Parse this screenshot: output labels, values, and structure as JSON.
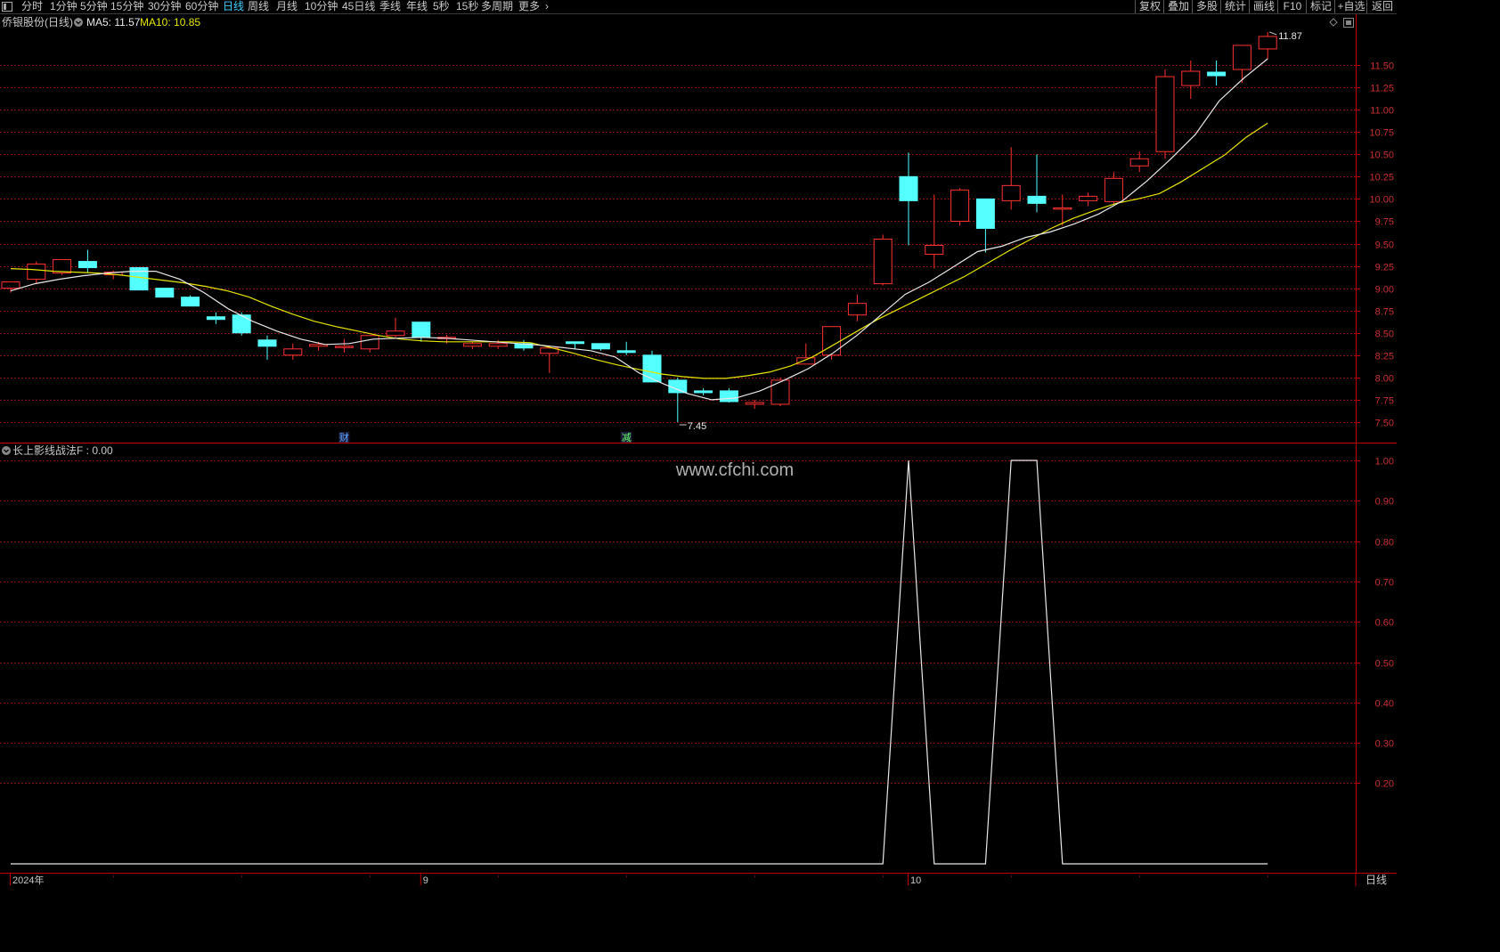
{
  "toolbar": {
    "left_icon": "panel-toggle-icon",
    "periods": [
      {
        "label": "分时",
        "active": false
      },
      {
        "label": "1分钟",
        "active": false
      },
      {
        "label": "5分钟",
        "active": false
      },
      {
        "label": "15分钟",
        "active": false
      },
      {
        "label": "30分钟",
        "active": false
      },
      {
        "label": "60分钟",
        "active": false
      },
      {
        "label": "日线",
        "active": true
      },
      {
        "label": "周线",
        "active": false
      },
      {
        "label": "月线",
        "active": false
      },
      {
        "label": "10分钟",
        "active": false
      },
      {
        "label": "45日线",
        "active": false
      },
      {
        "label": "季线",
        "active": false
      },
      {
        "label": "年线",
        "active": false
      },
      {
        "label": "5秒",
        "active": false
      },
      {
        "label": "15秒",
        "active": false
      },
      {
        "label": "多周期",
        "active": false
      },
      {
        "label": "更多",
        "active": false
      }
    ],
    "right_buttons": [
      "复权",
      "叠加",
      "多股",
      "统计",
      "画线",
      "F10",
      "标记",
      "+自选",
      "返回"
    ]
  },
  "main_chart": {
    "title": "侨银股份(日线)",
    "ma5_label": "MA5: 11.57",
    "ma10_label": "MA10: 10.85",
    "ma5_color": "#e8e8e8",
    "ma10_color": "#e5e500",
    "up_color": "#ff3232",
    "down_color": "#54ffff",
    "high_marker": "11.87",
    "low_marker": "7.45",
    "event_markers": [
      {
        "text": "财",
        "index": 13,
        "color": "#5fa8ff"
      },
      {
        "text": "减",
        "index": 24,
        "color": "#66ff66"
      }
    ],
    "icons": [
      "diamond-icon",
      "window-restore-icon"
    ]
  },
  "sub_chart": {
    "title": "长上影线战法F : 0.00",
    "watermark": "www.cfchi.com"
  },
  "x_axis": {
    "labels": [
      {
        "text": "2024年",
        "index": 0
      },
      {
        "text": "9",
        "index": 16
      },
      {
        "text": "10",
        "index": 35
      }
    ],
    "period_label": "日线"
  },
  "chart_data": [
    {
      "type": "candlestick",
      "title": "侨银股份(日线)",
      "y_ticks": [
        7.5,
        7.75,
        8.0,
        8.25,
        8.5,
        8.75,
        9.0,
        9.25,
        9.5,
        9.75,
        10.0,
        10.25,
        10.5,
        10.75,
        11.0,
        11.25,
        11.5
      ],
      "ylim": [
        7.25,
        11.95
      ],
      "series_legend": [
        {
          "name": "MA5",
          "value": 11.57
        },
        {
          "name": "MA10",
          "value": 10.85
        }
      ],
      "candles": [
        [
          9.0,
          9.07,
          8.95,
          9.0
        ],
        [
          9.1,
          9.27,
          9.05,
          9.3
        ],
        [
          9.17,
          9.32,
          9.15,
          9.32
        ],
        [
          9.3,
          9.23,
          9.17,
          9.43
        ],
        [
          9.15,
          9.18,
          9.1,
          9.2
        ],
        [
          9.23,
          8.98,
          8.98,
          9.23
        ],
        [
          9.0,
          8.9,
          8.9,
          9.0
        ],
        [
          8.9,
          8.8,
          8.8,
          8.92
        ],
        [
          8.68,
          8.65,
          8.6,
          8.73
        ],
        [
          8.7,
          8.5,
          8.47,
          8.73
        ],
        [
          8.42,
          8.35,
          8.2,
          8.47
        ],
        [
          8.25,
          8.32,
          8.2,
          8.38
        ],
        [
          8.35,
          8.37,
          8.3,
          8.4
        ],
        [
          8.35,
          8.35,
          8.28,
          8.43
        ],
        [
          8.32,
          8.47,
          8.28,
          8.47
        ],
        [
          8.47,
          8.52,
          8.45,
          8.67
        ],
        [
          8.62,
          8.45,
          8.4,
          8.62
        ],
        [
          8.45,
          8.45,
          8.38,
          8.48
        ],
        [
          8.35,
          8.38,
          8.32,
          8.4
        ],
        [
          8.35,
          8.38,
          8.32,
          8.42
        ],
        [
          8.38,
          8.33,
          8.3,
          8.42
        ],
        [
          8.27,
          8.33,
          8.05,
          8.33
        ],
        [
          8.4,
          8.38,
          8.32,
          8.4
        ],
        [
          8.38,
          8.32,
          8.3,
          8.38
        ],
        [
          8.3,
          8.28,
          8.25,
          8.4
        ],
        [
          8.25,
          7.95,
          7.95,
          8.3
        ],
        [
          7.97,
          7.83,
          7.5,
          8.0
        ],
        [
          7.85,
          7.83,
          7.8,
          7.88
        ],
        [
          7.85,
          7.73,
          7.72,
          7.88
        ],
        [
          7.7,
          7.72,
          7.65,
          7.75
        ],
        [
          7.7,
          7.97,
          7.68,
          8.0
        ],
        [
          8.15,
          8.22,
          8.15,
          8.38
        ],
        [
          8.25,
          8.57,
          8.2,
          8.57
        ],
        [
          8.7,
          8.83,
          8.63,
          8.93
        ],
        [
          9.05,
          9.55,
          9.03,
          9.6
        ],
        [
          10.25,
          9.98,
          9.48,
          10.52
        ],
        [
          9.38,
          9.48,
          9.22,
          10.05
        ],
        [
          9.75,
          10.1,
          9.7,
          10.12
        ],
        [
          10.0,
          9.67,
          9.4,
          10.0
        ],
        [
          9.98,
          10.15,
          9.88,
          10.58
        ],
        [
          10.03,
          9.95,
          9.85,
          10.5
        ],
        [
          9.9,
          9.9,
          9.7,
          10.05
        ],
        [
          9.98,
          10.03,
          9.92,
          10.07
        ],
        [
          9.97,
          10.23,
          9.93,
          10.3
        ],
        [
          10.37,
          10.45,
          10.3,
          10.53
        ],
        [
          10.53,
          11.37,
          10.45,
          11.45
        ],
        [
          11.27,
          11.43,
          11.12,
          11.55
        ],
        [
          11.42,
          11.38,
          11.27,
          11.55
        ],
        [
          11.45,
          11.72,
          11.3,
          11.72
        ],
        [
          11.68,
          11.82,
          11.57,
          11.87
        ]
      ],
      "ma5": [
        8.97,
        9.05,
        9.1,
        9.14,
        9.17,
        9.19,
        9.19,
        9.1,
        8.95,
        8.77,
        8.63,
        8.52,
        8.43,
        8.37,
        8.38,
        8.43,
        8.44,
        8.45,
        8.44,
        8.42,
        8.4,
        8.38,
        8.36,
        8.33,
        8.3,
        8.23,
        8.05,
        7.93,
        7.82,
        7.75,
        7.77,
        7.85,
        7.97,
        8.1,
        8.27,
        8.47,
        8.7,
        8.93,
        9.07,
        9.24,
        9.41,
        9.47,
        9.57,
        9.63,
        9.72,
        9.83,
        9.98,
        10.2,
        10.45,
        10.72,
        11.1,
        11.35,
        11.57
      ],
      "ma10": [
        9.22,
        9.21,
        9.19,
        9.18,
        9.17,
        9.15,
        9.12,
        9.09,
        9.06,
        9.02,
        8.97,
        8.9,
        8.8,
        8.71,
        8.63,
        8.57,
        8.52,
        8.47,
        8.43,
        8.41,
        8.4,
        8.4,
        8.4,
        8.4,
        8.39,
        8.33,
        8.27,
        8.2,
        8.14,
        8.09,
        8.04,
        8.01,
        7.99,
        7.99,
        8.02,
        8.06,
        8.13,
        8.23,
        8.37,
        8.51,
        8.65,
        8.77,
        8.89,
        9.01,
        9.13,
        9.27,
        9.41,
        9.54,
        9.67,
        9.78,
        9.87,
        9.95,
        10.0
      ],
      "ma10_tail": [
        10.06,
        10.19,
        10.34,
        10.49,
        10.69,
        10.85
      ]
    },
    {
      "type": "line",
      "title": "长上影线战法F : 0.00",
      "y_ticks": [
        0.2,
        0.3,
        0.4,
        0.5,
        0.6,
        0.7,
        0.8,
        0.9,
        1.0
      ],
      "ylim": [
        0,
        1.0
      ],
      "series": [
        {
          "name": "长上影线战法F",
          "values": [
            0,
            0,
            0,
            0,
            0,
            0,
            0,
            0,
            0,
            0,
            0,
            0,
            0,
            0,
            0,
            0,
            0,
            0,
            0,
            0,
            0,
            0,
            0,
            0,
            0,
            0,
            0,
            0,
            0,
            0,
            0,
            0,
            0,
            0,
            0,
            1,
            0,
            0,
            0,
            1,
            1,
            0,
            0,
            0,
            0,
            0,
            0,
            0,
            0,
            0
          ]
        }
      ]
    }
  ]
}
